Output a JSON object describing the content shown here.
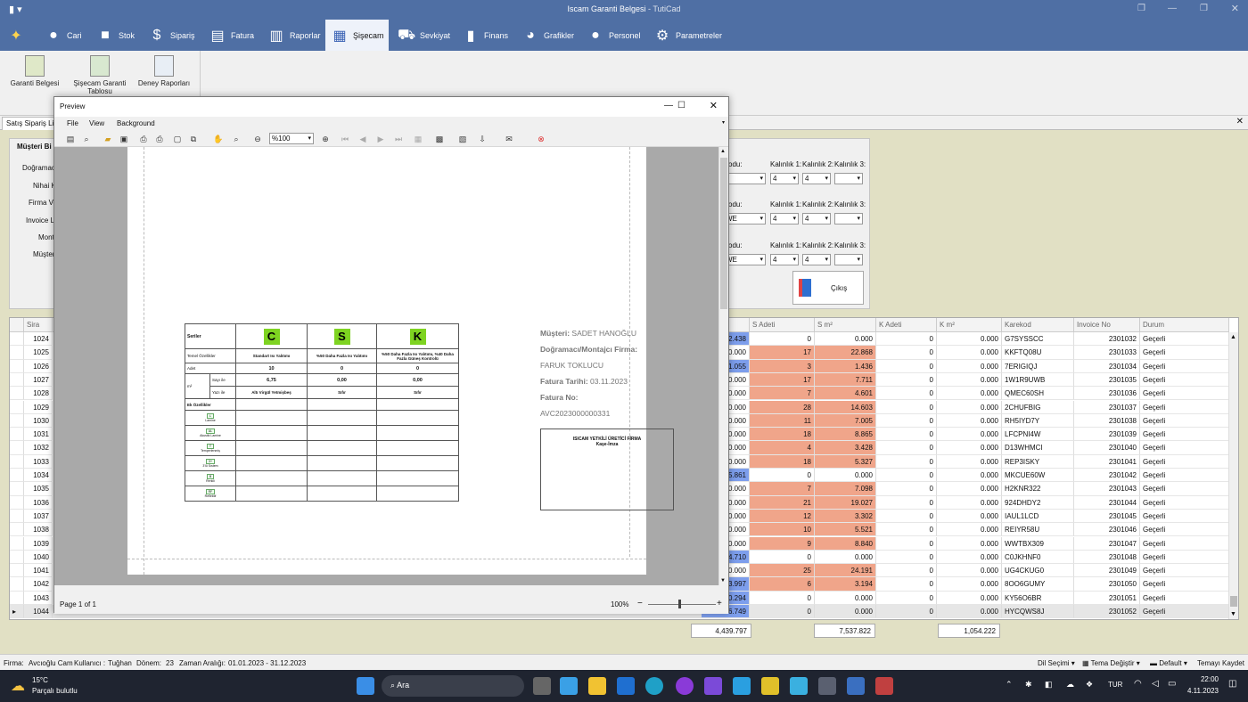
{
  "app": {
    "title": "Iscam Garanti Belgesi",
    "subtitle": " - TutiCad"
  },
  "menu": [
    {
      "label": "Cari",
      "icon": "user-icon"
    },
    {
      "label": "Stok",
      "icon": "box-icon"
    },
    {
      "label": "Sipariş",
      "icon": "order-icon"
    },
    {
      "label": "Fatura",
      "icon": "invoice-icon"
    },
    {
      "label": "Raporlar",
      "icon": "report-icon"
    },
    {
      "label": "Şişecam",
      "icon": "grid-icon"
    },
    {
      "label": "Sevkiyat",
      "icon": "truck-icon"
    },
    {
      "label": "Finans",
      "icon": "bar-chart-icon"
    },
    {
      "label": "Grafikler",
      "icon": "pie-chart-icon"
    },
    {
      "label": "Personel",
      "icon": "people-icon"
    },
    {
      "label": "Parametreler",
      "icon": "gear-icon"
    }
  ],
  "ribbon": [
    {
      "label": "Garanti Belgesi"
    },
    {
      "label": "Şişecam Garanti Tablosu"
    },
    {
      "label": "Deney Raporları"
    }
  ],
  "tab": {
    "label": "Satış Sipariş List"
  },
  "form": {
    "section": "Müşteri Bi",
    "labels": [
      "Doğramacı",
      "Nihai K",
      "Firma Ve",
      "Invoice L",
      "Mont",
      "Müşter"
    ]
  },
  "right_panel": {
    "rows": [
      {
        "kodu_label": "odu:",
        "kodu_val": "",
        "k1_label": "Kalınlık 1:",
        "k1": "4",
        "k2_label": "Kalınlık 2:",
        "k2": "4",
        "k3_label": "Kalınlık 3:",
        "k3": ""
      },
      {
        "kodu_label": "odu:",
        "kodu_val": "WE",
        "k1_label": "Kalınlık 1:",
        "k1": "4",
        "k2_label": "Kalınlık 2:",
        "k2": "4",
        "k3_label": "Kalınlık 3:",
        "k3": ""
      },
      {
        "kodu_label": "odu:",
        "kodu_val": "WE",
        "k1_label": "Kalınlık 1:",
        "k1": "4",
        "k2_label": "Kalınlık 2:",
        "k2": "4",
        "k3_label": "Kalınlık 3:",
        "k3": ""
      }
    ],
    "exit_label": "Çıkış"
  },
  "grid": {
    "headers": {
      "sira": "Sira",
      "s_adeti": "S Adeti",
      "s_m2": "S m²",
      "k_adeti": "K Adeti",
      "k_m2": "K m²",
      "karekod": "Karekod",
      "invoice": "Invoice No",
      "durum": "Durum"
    },
    "rows": [
      {
        "sira": "1024",
        "pre": "2.438",
        "sa": "0",
        "sm": "0.000",
        "ka": "0",
        "km": "0.000",
        "kk": "G7SYSSCC",
        "inv": "2301032",
        "d": "Geçerli"
      },
      {
        "sira": "1025",
        "pre": "0.000",
        "sa": "17",
        "sm": "22.868",
        "ka": "0",
        "km": "0.000",
        "kk": "KKFTQ08U",
        "inv": "2301033",
        "d": "Geçerli"
      },
      {
        "sira": "1026",
        "pre": "1.055",
        "sa": "3",
        "sm": "1.436",
        "ka": "0",
        "km": "0.000",
        "kk": "7ERIGIQJ",
        "inv": "2301034",
        "d": "Geçerli"
      },
      {
        "sira": "1027",
        "pre": "0.000",
        "sa": "17",
        "sm": "7.711",
        "ka": "0",
        "km": "0.000",
        "kk": "1W1R9UWB",
        "inv": "2301035",
        "d": "Geçerli"
      },
      {
        "sira": "1028",
        "pre": "0.000",
        "sa": "7",
        "sm": "4.601",
        "ka": "0",
        "km": "0.000",
        "kk": "QMEC60SH",
        "inv": "2301036",
        "d": "Geçerli"
      },
      {
        "sira": "1029",
        "pre": "0.000",
        "sa": "28",
        "sm": "14.603",
        "ka": "0",
        "km": "0.000",
        "kk": "2CHUFBIG",
        "inv": "2301037",
        "d": "Geçerli"
      },
      {
        "sira": "1030",
        "pre": "0.000",
        "sa": "11",
        "sm": "7.005",
        "ka": "0",
        "km": "0.000",
        "kk": "RH5IYD7Y",
        "inv": "2301038",
        "d": "Geçerli"
      },
      {
        "sira": "1031",
        "pre": "0.000",
        "sa": "18",
        "sm": "8.865",
        "ka": "0",
        "km": "0.000",
        "kk": "LFCPNI4W",
        "inv": "2301039",
        "d": "Geçerli"
      },
      {
        "sira": "1032",
        "pre": "0.000",
        "sa": "4",
        "sm": "3.428",
        "ka": "0",
        "km": "0.000",
        "kk": "D13WHMCI",
        "inv": "2301040",
        "d": "Geçerli"
      },
      {
        "sira": "1033",
        "pre": "0.000",
        "sa": "18",
        "sm": "5.327",
        "ka": "0",
        "km": "0.000",
        "kk": "REP3ISKY",
        "inv": "2301041",
        "d": "Geçerli"
      },
      {
        "sira": "1034",
        "pre": "5.861",
        "sa": "0",
        "sm": "0.000",
        "ka": "0",
        "km": "0.000",
        "kk": "MKCUE60W",
        "inv": "2301042",
        "d": "Geçerli"
      },
      {
        "sira": "1035",
        "pre": "0.000",
        "sa": "7",
        "sm": "7.098",
        "ka": "0",
        "km": "0.000",
        "kk": "H2KNR322",
        "inv": "2301043",
        "d": "Geçerli"
      },
      {
        "sira": "1036",
        "pre": "0.000",
        "sa": "21",
        "sm": "19.027",
        "ka": "0",
        "km": "0.000",
        "kk": "924DHDY2",
        "inv": "2301044",
        "d": "Geçerli"
      },
      {
        "sira": "1037",
        "pre": "0.000",
        "sa": "12",
        "sm": "3.302",
        "ka": "0",
        "km": "0.000",
        "kk": "IAUL1LCD",
        "inv": "2301045",
        "d": "Geçerli"
      },
      {
        "sira": "1038",
        "pre": "0.000",
        "sa": "10",
        "sm": "5.521",
        "ka": "0",
        "km": "0.000",
        "kk": "REIYR58U",
        "inv": "2301046",
        "d": "Geçerli"
      },
      {
        "sira": "1039",
        "pre": "0.000",
        "sa": "9",
        "sm": "8.840",
        "ka": "0",
        "km": "0.000",
        "kk": "WWTBX309",
        "inv": "2301047",
        "d": "Geçerli"
      },
      {
        "sira": "1040",
        "pre": "4.710",
        "sa": "0",
        "sm": "0.000",
        "ka": "0",
        "km": "0.000",
        "kk": "C0JKHNF0",
        "inv": "2301048",
        "d": "Geçerli"
      },
      {
        "sira": "1041",
        "pre": "0.000",
        "sa": "25",
        "sm": "24.191",
        "ka": "0",
        "km": "0.000",
        "kk": "UG4CKUG0",
        "inv": "2301049",
        "d": "Geçerli"
      },
      {
        "sira": "1042",
        "pre": "3.997",
        "sa": "6",
        "sm": "3.194",
        "ka": "0",
        "km": "0.000",
        "kk": "8OO6GUMY",
        "inv": "2301050",
        "d": "Geçerli"
      },
      {
        "sira": "1043",
        "pre": "0.294",
        "sa": "0",
        "sm": "0.000",
        "ka": "0",
        "km": "0.000",
        "kk": "KY56O6BR",
        "inv": "2301051",
        "d": "Geçerli"
      },
      {
        "sira": "1044",
        "pre": "6.749",
        "sa": "0",
        "sm": "0.000",
        "ka": "0",
        "km": "0.000",
        "kk": "HYCQWS8J",
        "inv": "2301052",
        "d": "Geçerli"
      }
    ],
    "totals": {
      "t1": "4,439.797",
      "t2": "7,537.822",
      "t3": "1,054.222"
    }
  },
  "preview": {
    "title": "Preview",
    "menu": [
      "File",
      "View",
      "Background"
    ],
    "zoom": "%100",
    "page": "Page 1 of 1",
    "zoom_pct": "100%",
    "doc": {
      "seriler": "Seriler",
      "temel": "Temel Özellikler",
      "adet": "Adet",
      "sayi": "Sayı ile",
      "yazi": "Yazı ile",
      "ek": "Ek Özellikler",
      "c": "C",
      "s": "S",
      "k": "K",
      "c_desc": "Standart Isı Yalıtımı",
      "s_desc": "%50 Daha Fazla Isı Yalıtımı",
      "k_desc": "%50 Daha Fazla Isı Yalıtımı, %40 Daha Fazla Güneş Kontrolü",
      "c_adet": "10",
      "s_adet": "0",
      "k_adet": "0",
      "c_sayi": "6,75",
      "s_sayi": "0,00",
      "k_sayi": "0,00",
      "c_yazi": "Altı Virgül Yetmişbeş",
      "s_yazi": "Sıfır",
      "k_yazi": "Sıfır",
      "extras": [
        {
          "code": "L",
          "name": "Lamine"
        },
        {
          "code": "AL",
          "name": "Akustik Lamine"
        },
        {
          "code": "T",
          "name": "Temperlenmiş"
        },
        {
          "code": "3+",
          "name": "3'lü Sıstem"
        },
        {
          "code": "B",
          "name": "Renkli"
        },
        {
          "code": "RF",
          "name": "Reflektif"
        }
      ],
      "m2": "m²",
      "musteri_label": "Müşteri:",
      "musteri": " SADET HANOĞLU",
      "firma_label": "Doğramacı/Montajcı Firma:",
      "firma": "FARUK TOKLUCU",
      "tarih_label": "Fatura Tarihi:",
      "tarih": " 03.11.2023",
      "no_label": "Fatura No:",
      "no": "AVC2023000000331",
      "stamp1": "ISICAM YETKİLİ ÜRETİCİ FİRMA",
      "stamp2": "Kaşe-İmza"
    }
  },
  "status": {
    "firma_label": "Firma:",
    "firma": "Avcıoğlu Cam",
    "kullanici_label": "Kullanıcı :",
    "kullanici": "Tuğhan",
    "donem_label": "Dönem:",
    "donem": "23",
    "zaman_label": "Zaman Aralığı:",
    "zaman": "01.01.2023 - 31.12.2023",
    "dil": "Dil Seçimi",
    "tema": "Tema Değiştir",
    "default": "Default",
    "kaydet": "Temayı Kaydet"
  },
  "taskbar": {
    "temp": "15°C",
    "weather": "Parçalı bulutlu",
    "search": "Ara",
    "lang": "TUR",
    "time": "22:00",
    "date": "4.11.2023"
  }
}
